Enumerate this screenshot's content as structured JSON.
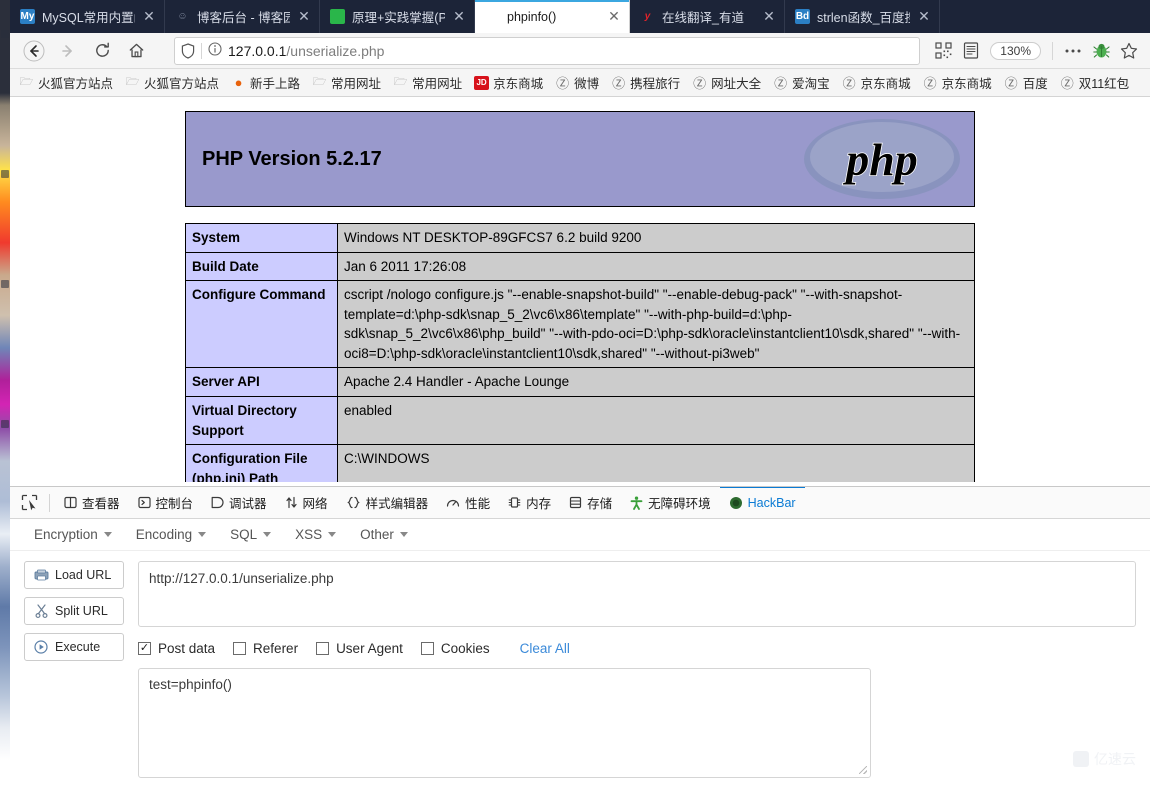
{
  "browser": {
    "tabs": [
      {
        "title": "MySQL常用内置函数整",
        "favicon": "mysql-icon",
        "active": false
      },
      {
        "title": "博客后台 - 博客园",
        "favicon": "user-icon",
        "active": false
      },
      {
        "title": "原理+实践掌握(PHP反",
        "favicon": "green-circle-icon",
        "active": false
      },
      {
        "title": "phpinfo()",
        "favicon": "php-icon",
        "active": true
      },
      {
        "title": "在线翻译_有道",
        "favicon": "youdao-icon",
        "active": false
      },
      {
        "title": "strlen函数_百度搜索",
        "favicon": "baidu-icon",
        "active": false
      }
    ],
    "nav": {
      "back_icon": "back-arrow-icon",
      "forward_icon": "forward-arrow-icon",
      "reload_icon": "reload-icon",
      "home_icon": "home-icon",
      "shield_icon": "shield-icon",
      "info_icon": "info-circle-icon",
      "url_host": "127.0.0.1",
      "url_path": "/unserialize.php",
      "url_full": "127.0.0.1/unserialize.php",
      "qr_icon": "qr-code-icon",
      "reader_icon": "reader-view-icon",
      "zoom_level": "130%",
      "menu_icon": "ellipsis-icon",
      "bug_icon": "bug-icon",
      "star_icon": "star-icon"
    },
    "bookmarks": [
      {
        "label": "火狐官方站点",
        "icon": "folder-icon"
      },
      {
        "label": "火狐官方站点",
        "icon": "folder-icon"
      },
      {
        "label": "新手上路",
        "icon": "firefox-icon"
      },
      {
        "label": "常用网址",
        "icon": "folder-icon"
      },
      {
        "label": "常用网址",
        "icon": "folder-icon"
      },
      {
        "label": "京东商城",
        "icon": "jd-icon"
      },
      {
        "label": "微博",
        "icon": "globe-icon"
      },
      {
        "label": "携程旅行",
        "icon": "globe-icon"
      },
      {
        "label": "网址大全",
        "icon": "globe-icon"
      },
      {
        "label": "爱淘宝",
        "icon": "globe-icon"
      },
      {
        "label": "京东商城",
        "icon": "globe-icon"
      },
      {
        "label": "京东商城",
        "icon": "globe-icon"
      },
      {
        "label": "百度",
        "icon": "globe-icon"
      },
      {
        "label": "双11红包",
        "icon": "globe-icon"
      }
    ]
  },
  "phpinfo": {
    "version_title": "PHP Version 5.2.17",
    "logo_text": "php",
    "header_bg": "#9999cc",
    "key_bg": "#ccccff",
    "value_bg": "#cccccc",
    "rows": [
      {
        "key": "System",
        "value": "Windows NT DESKTOP-89GFCS7 6.2 build 9200"
      },
      {
        "key": "Build Date",
        "value": "Jan 6 2011 17:26:08"
      },
      {
        "key": "Configure Command",
        "value": "cscript /nologo configure.js \"--enable-snapshot-build\" \"--enable-debug-pack\" \"--with-snapshot-template=d:\\php-sdk\\snap_5_2\\vc6\\x86\\template\" \"--with-php-build=d:\\php-sdk\\snap_5_2\\vc6\\x86\\php_build\" \"--with-pdo-oci=D:\\php-sdk\\oracle\\instantclient10\\sdk,shared\" \"--with-oci8=D:\\php-sdk\\oracle\\instantclient10\\sdk,shared\" \"--without-pi3web\""
      },
      {
        "key": "Server API",
        "value": "Apache 2.4 Handler - Apache Lounge"
      },
      {
        "key": "Virtual Directory Support",
        "value": "enabled"
      },
      {
        "key": "Configuration File (php.ini) Path",
        "value": "C:\\WINDOWS"
      }
    ]
  },
  "devtools": {
    "picker_icon": "element-picker-icon",
    "tabs": [
      {
        "label": "查看器",
        "icon": "inspector-icon",
        "active": false
      },
      {
        "label": "控制台",
        "icon": "console-icon",
        "active": false
      },
      {
        "label": "调试器",
        "icon": "debugger-icon",
        "active": false
      },
      {
        "label": "网络",
        "icon": "network-icon",
        "active": false
      },
      {
        "label": "样式编辑器",
        "icon": "style-editor-icon",
        "active": false
      },
      {
        "label": "性能",
        "icon": "performance-icon",
        "active": false
      },
      {
        "label": "内存",
        "icon": "memory-icon",
        "active": false
      },
      {
        "label": "存储",
        "icon": "storage-icon",
        "active": false
      },
      {
        "label": "无障碍环境",
        "icon": "accessibility-icon",
        "active": false
      },
      {
        "label": "HackBar",
        "icon": "hackbar-icon",
        "active": true
      }
    ],
    "active_color": "#0b7bd4"
  },
  "hackbar": {
    "menus": [
      {
        "label": "Encryption"
      },
      {
        "label": "Encoding"
      },
      {
        "label": "SQL"
      },
      {
        "label": "XSS"
      },
      {
        "label": "Other"
      }
    ],
    "buttons": [
      {
        "label": "Load URL",
        "icon": "load-url-icon"
      },
      {
        "label": "Split URL",
        "icon": "split-url-icon"
      },
      {
        "label": "Execute",
        "icon": "execute-icon"
      }
    ],
    "url_value": "http://127.0.0.1/unserialize.php",
    "url_placeholder": "http://",
    "checkboxes": [
      {
        "label": "Post data",
        "checked": true
      },
      {
        "label": "Referer",
        "checked": false
      },
      {
        "label": "User Agent",
        "checked": false
      },
      {
        "label": "Cookies",
        "checked": false
      }
    ],
    "clear_all_label": "Clear All",
    "post_data_value": "test=phpinfo()",
    "post_data_placeholder": ""
  },
  "watermark": {
    "text": "亿速云"
  }
}
